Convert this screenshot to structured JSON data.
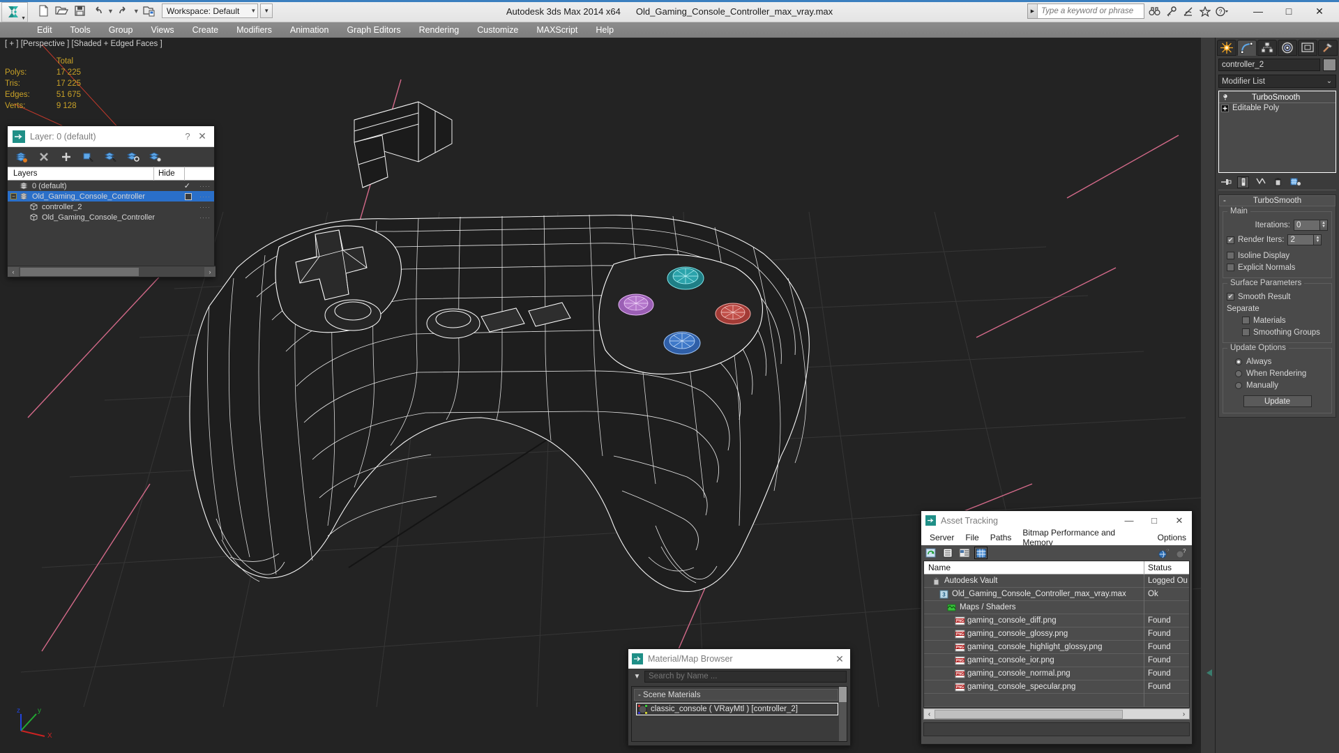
{
  "app": {
    "title_product": "Autodesk 3ds Max  2014 x64",
    "title_file": "Old_Gaming_Console_Controller_max_vray.max",
    "workspace_label": "Workspace: Default",
    "accent_color": "#3b7fbf"
  },
  "quick_access": [
    {
      "name": "new-file-icon",
      "label": "New"
    },
    {
      "name": "open-file-icon",
      "label": "Open"
    },
    {
      "name": "save-file-icon",
      "label": "Save"
    },
    {
      "name": "undo-icon",
      "label": "Undo"
    },
    {
      "name": "redo-icon",
      "label": "Redo"
    },
    {
      "name": "set-project-folder-icon",
      "label": "Set Project Folder"
    }
  ],
  "search": {
    "placeholder": "Type a keyword or phrase"
  },
  "help_icons": [
    {
      "name": "search-binoculars-icon"
    },
    {
      "name": "key-icon"
    },
    {
      "name": "satellite-dish-icon"
    },
    {
      "name": "favorites-star-icon"
    },
    {
      "name": "help-question-icon"
    }
  ],
  "window_controls": {
    "minimize": "—",
    "maximize": "□",
    "close": "✕"
  },
  "menubar": [
    "Edit",
    "Tools",
    "Group",
    "Views",
    "Create",
    "Modifiers",
    "Animation",
    "Graph Editors",
    "Rendering",
    "Customize",
    "MAXScript",
    "Help"
  ],
  "viewport": {
    "label": "[ + ] [Perspective ] [Shaded + Edged Faces ]",
    "stats": {
      "header": "Total",
      "rows": [
        {
          "label": "Polys:",
          "value": "17 225"
        },
        {
          "label": "Tris:",
          "value": "17 225"
        },
        {
          "label": "Edges:",
          "value": "51 675"
        },
        {
          "label": "Verts:",
          "value": "9 128"
        }
      ]
    },
    "axis_gizmo": {
      "x": "X",
      "y": "y",
      "z": "z"
    }
  },
  "layer_dialog": {
    "title": "Layer: 0 (default)",
    "help_glyph": "?",
    "close_glyph": "✕",
    "toolbar": [
      {
        "name": "create-new-layer-icon"
      },
      {
        "name": "delete-layer-icon"
      },
      {
        "name": "add-selection-to-layer-icon"
      },
      {
        "name": "select-objects-in-layer-icon"
      },
      {
        "name": "select-highlighted-layers-icon"
      },
      {
        "name": "highlight-selected-objects-layer-icon"
      },
      {
        "name": "layer-properties-icon"
      }
    ],
    "columns": {
      "name": "Layers",
      "hide": "Hide",
      "freeze": ""
    },
    "rows": [
      {
        "name": "0 (default)",
        "indent": 0,
        "icon": "layer-icon",
        "selected": false,
        "expander": "none",
        "mark": "check",
        "dots": "····"
      },
      {
        "name": "Old_Gaming_Console_Controller",
        "indent": 0,
        "icon": "layer-icon",
        "selected": true,
        "expander": "minus",
        "mark": "box",
        "dots": "····"
      },
      {
        "name": "controller_2",
        "indent": 1,
        "icon": "object-box-icon",
        "selected": false,
        "expander": "none",
        "mark": "none",
        "dots": "····"
      },
      {
        "name": "Old_Gaming_Console_Controller",
        "indent": 1,
        "icon": "object-box-icon",
        "selected": false,
        "expander": "none",
        "mark": "none",
        "dots": "····"
      }
    ],
    "scroll_left": "‹",
    "scroll_right": "›"
  },
  "material_browser": {
    "title": "Material/Map Browser",
    "close_glyph": "✕",
    "search_placeholder": "Search by Name ...",
    "filter_glyph": "▼",
    "group_label": "- Scene Materials",
    "items": [
      {
        "label": "classic_console  ( VRayMtl )  [controller_2]",
        "selected": true
      }
    ]
  },
  "asset_tracking": {
    "title": "Asset Tracking",
    "window_controls": {
      "minimize": "—",
      "maximize": "□",
      "close": "✕"
    },
    "menu": [
      "Server",
      "File",
      "Paths",
      "Bitmap Performance and Memory",
      "Options"
    ],
    "toolbar": [
      {
        "name": "refresh-icon",
        "active": false
      },
      {
        "name": "list-view-icon",
        "active": false
      },
      {
        "name": "details-view-icon",
        "active": false
      },
      {
        "name": "grid-view-icon",
        "active": true
      }
    ],
    "toolbar_right": [
      {
        "name": "help-globe-icon"
      },
      {
        "name": "help-icon"
      }
    ],
    "columns": [
      "Name",
      "Status"
    ],
    "rows": [
      {
        "name": "Autodesk Vault",
        "status": "Logged Ou",
        "indent": 1,
        "icon": "vault-icon"
      },
      {
        "name": "Old_Gaming_Console_Controller_max_vray.max",
        "status": "Ok",
        "indent": 2,
        "icon": "max-file-icon"
      },
      {
        "name": "Maps / Shaders",
        "status": "",
        "indent": 3,
        "icon": "maps-shaders-icon"
      },
      {
        "name": "gaming_console_diff.png",
        "status": "Found",
        "indent": 4,
        "icon": "png-icon"
      },
      {
        "name": "gaming_console_glossy.png",
        "status": "Found",
        "indent": 4,
        "icon": "png-icon"
      },
      {
        "name": "gaming_console_highlight_glossy.png",
        "status": "Found",
        "indent": 4,
        "icon": "png-icon"
      },
      {
        "name": "gaming_console_ior.png",
        "status": "Found",
        "indent": 4,
        "icon": "png-icon"
      },
      {
        "name": "gaming_console_normal.png",
        "status": "Found",
        "indent": 4,
        "icon": "png-icon"
      },
      {
        "name": "gaming_console_specular.png",
        "status": "Found",
        "indent": 4,
        "icon": "png-icon"
      },
      {
        "name": "",
        "status": "",
        "indent": 0,
        "icon": "none"
      }
    ],
    "scroll_left": "‹",
    "scroll_right": "›"
  },
  "command_panel": {
    "tabs": [
      {
        "name": "create-tab",
        "icon": "star-burst-icon",
        "active": false
      },
      {
        "name": "modify-tab",
        "icon": "curve-icon",
        "active": true
      },
      {
        "name": "hierarchy-tab",
        "icon": "hierarchy-icon",
        "active": false
      },
      {
        "name": "motion-tab",
        "icon": "motion-wheel-icon",
        "active": false
      },
      {
        "name": "display-tab",
        "icon": "display-monitor-icon",
        "active": false
      },
      {
        "name": "utilities-tab",
        "icon": "hammer-icon",
        "active": false
      }
    ],
    "object_name": "controller_2",
    "modifier_list_label": "Modifier List",
    "modifier_stack": [
      {
        "label": "TurboSmooth",
        "icon": "light-bulb-icon",
        "selected": true
      },
      {
        "label": "Editable Poly",
        "icon": "plus-box-icon",
        "selected": false
      }
    ],
    "stack_tools": [
      {
        "name": "pin-stack-icon"
      },
      {
        "name": "show-end-result-icon",
        "active": true
      },
      {
        "name": "make-unique-icon"
      },
      {
        "name": "remove-modifier-icon"
      },
      {
        "name": "configure-modifier-sets-icon"
      }
    ],
    "rollout": {
      "title": "TurboSmooth",
      "collapse_glyph": "-",
      "groups": [
        {
          "label": "Main",
          "fields": [
            {
              "type": "spinner",
              "label": "Iterations:",
              "value": "0",
              "checkbox": null
            },
            {
              "type": "spinner",
              "label": "Render Iters:",
              "value": "2",
              "checkbox": true
            },
            {
              "type": "checkbox",
              "label": "Isoline Display",
              "checked": false
            },
            {
              "type": "checkbox",
              "label": "Explicit Normals",
              "checked": false
            }
          ]
        },
        {
          "label": "Surface Parameters",
          "fields": [
            {
              "type": "checkbox",
              "label": "Smooth Result",
              "checked": true
            },
            {
              "type": "text",
              "label": "Separate"
            },
            {
              "type": "checkbox",
              "label": "Materials",
              "checked": false,
              "indent": true
            },
            {
              "type": "checkbox",
              "label": "Smoothing Groups",
              "checked": false,
              "indent": true
            }
          ]
        },
        {
          "label": "Update Options",
          "fields": [
            {
              "type": "radio",
              "label": "Always",
              "checked": true
            },
            {
              "type": "radio",
              "label": "When Rendering",
              "checked": false
            },
            {
              "type": "radio",
              "label": "Manually",
              "checked": false
            },
            {
              "type": "button",
              "label": "Update"
            }
          ]
        }
      ]
    }
  }
}
